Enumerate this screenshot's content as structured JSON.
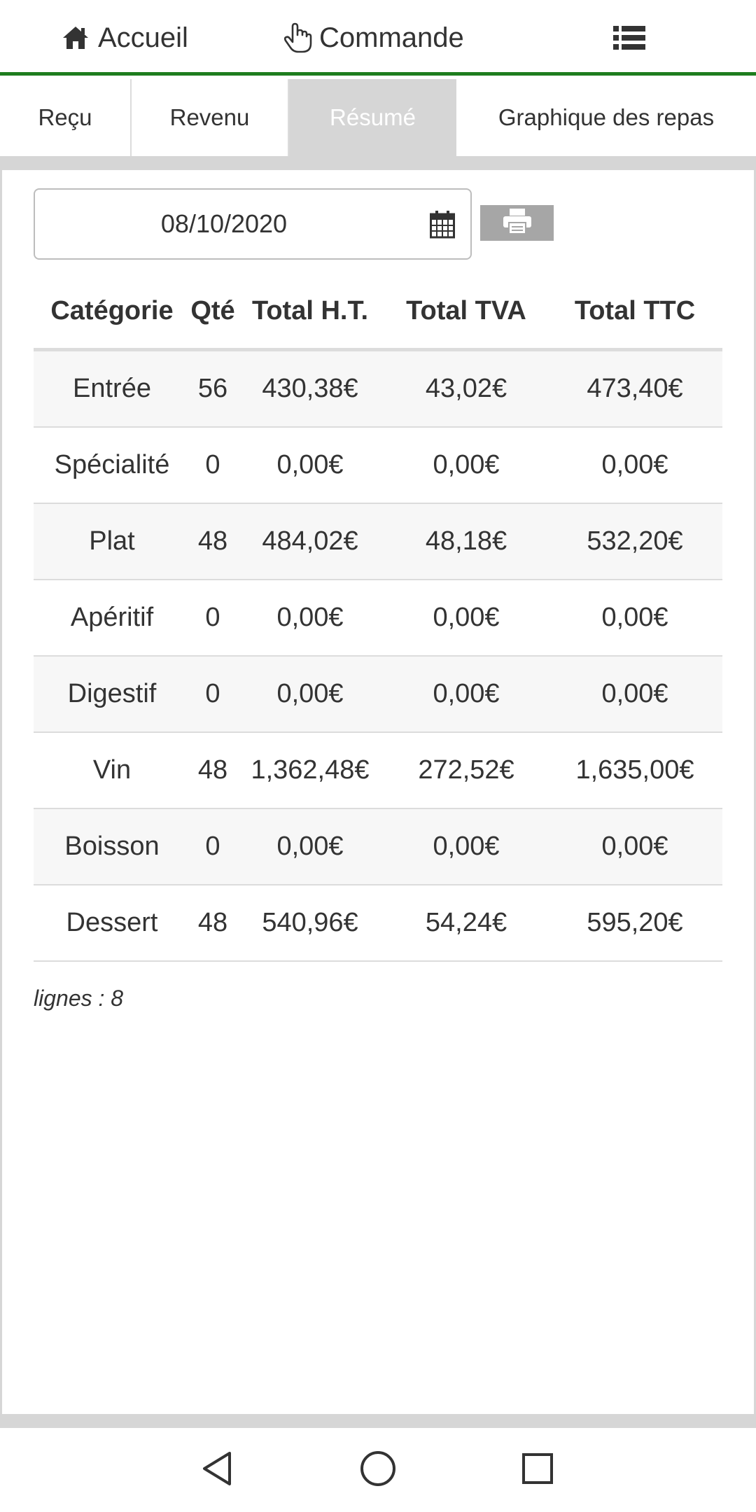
{
  "nav": {
    "home_label": "Accueil",
    "order_label": "Commande",
    "icons": [
      "home-icon",
      "hand-pointer-icon",
      "list-icon"
    ]
  },
  "tabs": [
    {
      "label": "Reçu",
      "active": false
    },
    {
      "label": "Revenu",
      "active": false
    },
    {
      "label": "Résumé",
      "active": true
    },
    {
      "label": "Graphique des repas",
      "active": false
    }
  ],
  "date": {
    "value": "08/10/2020"
  },
  "table": {
    "headers": [
      "Catégorie",
      "Qté",
      "Total H.T.",
      "Total TVA",
      "Total TTC"
    ],
    "rows": [
      [
        "Entrée",
        "56",
        "430,38€",
        "43,02€",
        "473,40€"
      ],
      [
        "Spécialité",
        "0",
        "0,00€",
        "0,00€",
        "0,00€"
      ],
      [
        "Plat",
        "48",
        "484,02€",
        "48,18€",
        "532,20€"
      ],
      [
        "Apéritif",
        "0",
        "0,00€",
        "0,00€",
        "0,00€"
      ],
      [
        "Digestif",
        "0",
        "0,00€",
        "0,00€",
        "0,00€"
      ],
      [
        "Vin",
        "48",
        "1,362,48€",
        "272,52€",
        "1,635,00€"
      ],
      [
        "Boisson",
        "0",
        "0,00€",
        "0,00€",
        "0,00€"
      ],
      [
        "Dessert",
        "48",
        "540,96€",
        "54,24€",
        "595,20€"
      ]
    ]
  },
  "footer": {
    "row_count": "lignes : 8"
  },
  "colors": {
    "accent": "#1e7d1e",
    "active_tab_bg": "#d6d6d6",
    "print_button_bg": "#a6a6a6"
  }
}
